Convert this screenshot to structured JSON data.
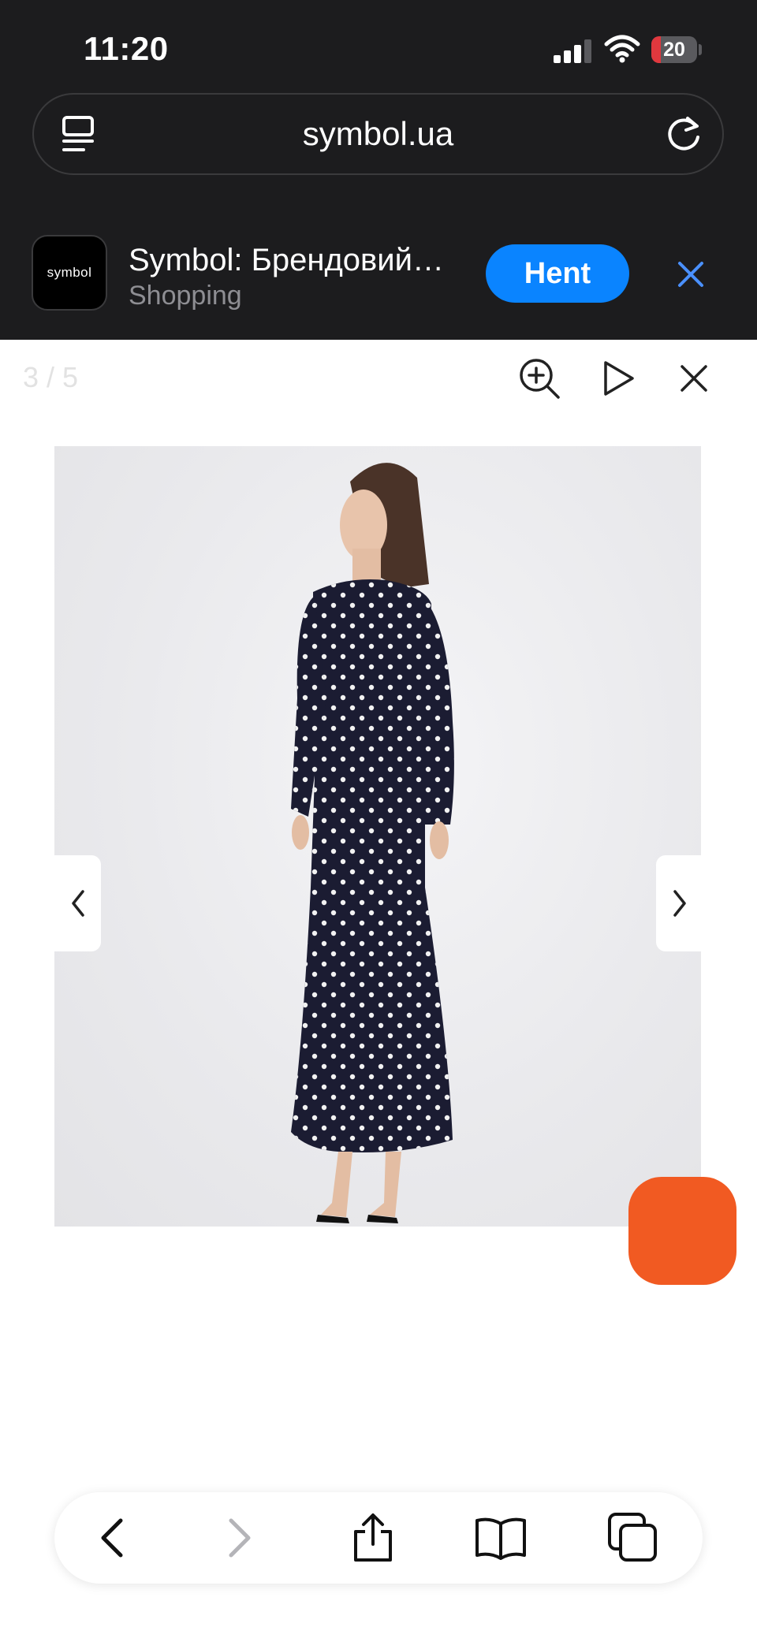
{
  "status_bar": {
    "time": "11:20",
    "battery_level": "20",
    "battery_fraction": 0.2,
    "battery_fill_color": "#e0383e",
    "signal_bars": 3
  },
  "browser": {
    "url": "symbol.ua",
    "tabs_icon": "tabs-overview-icon",
    "reload_icon": "reload-icon"
  },
  "app_banner": {
    "logo_text": "symbol",
    "app_name": "Symbol: Брендовий…",
    "category": "Shopping",
    "get_label": "Hent",
    "get_color": "#0a84ff",
    "close_icon": "close-icon"
  },
  "gallery": {
    "counter": "3 / 5",
    "zoom_icon": "zoom-in-icon",
    "play_icon": "play-icon",
    "close_icon": "close-icon",
    "prev_icon": "chevron-left-icon",
    "next_icon": "chevron-right-icon",
    "image_subject": "woman-in-navy-polka-dot-maxi-dress"
  },
  "chat_widget": {
    "color": "#f15a22"
  },
  "toolbar": {
    "back_icon": "back-icon",
    "forward_icon": "forward-icon",
    "share_icon": "share-icon",
    "bookmarks_icon": "bookmarks-icon",
    "tabs_icon": "tabs-icon"
  }
}
